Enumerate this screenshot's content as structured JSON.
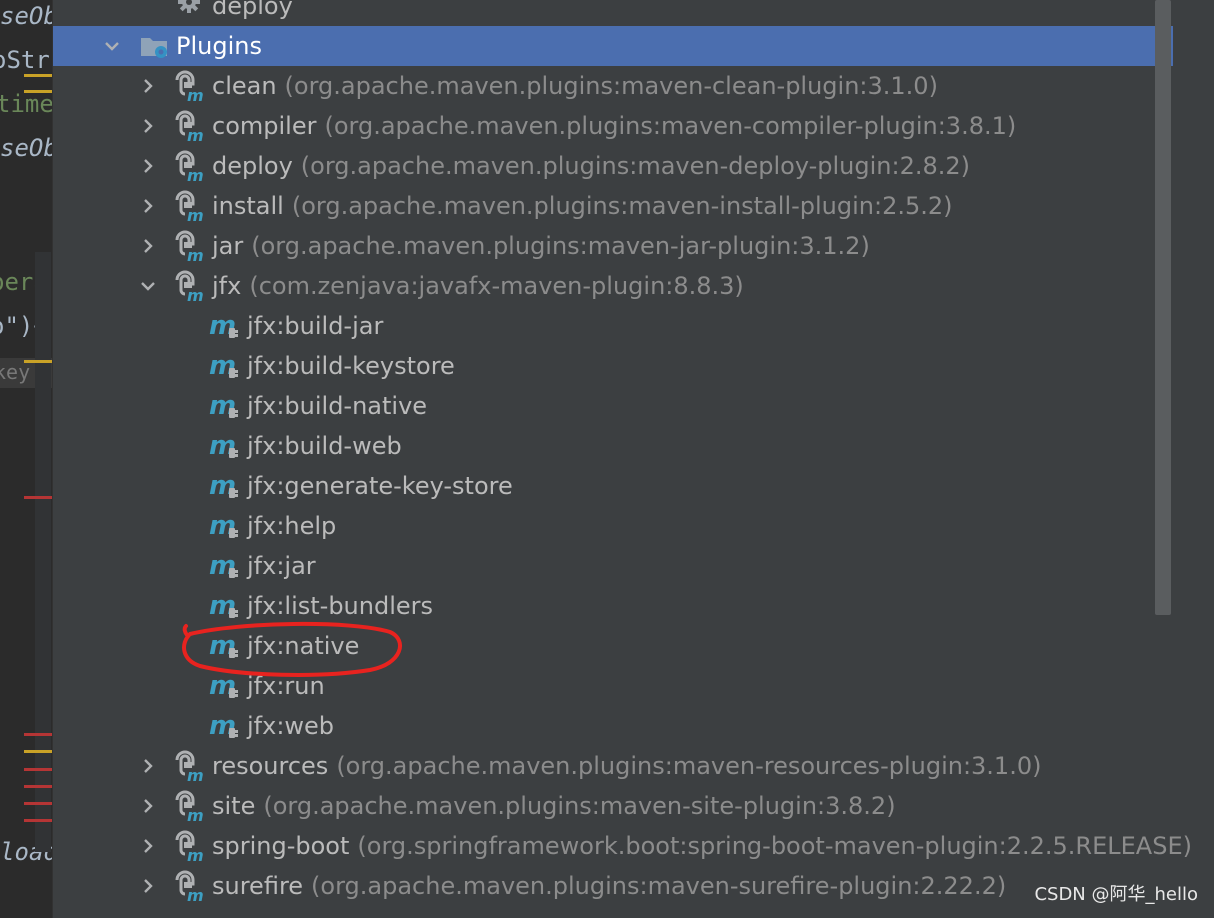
{
  "code_strip": {
    "fragments": [
      "seOb",
      "oStr",
      "time",
      "seOb",
      "pera",
      "o\")+",
      "key",
      "load"
    ]
  },
  "tree": {
    "items": [
      {
        "label": "deploy",
        "coord": "",
        "icon": "gear-icon",
        "level": 2,
        "chevron": "none",
        "selected": false
      },
      {
        "label": "Plugins",
        "coord": "",
        "icon": "plugins-folder-icon",
        "level": 1,
        "chevron": "expanded",
        "selected": true
      },
      {
        "label": "clean",
        "coord": "(org.apache.maven.plugins:maven-clean-plugin:3.1.0)",
        "icon": "maven-plugin-icon",
        "level": 2,
        "chevron": "collapsed",
        "selected": false
      },
      {
        "label": "compiler",
        "coord": "(org.apache.maven.plugins:maven-compiler-plugin:3.8.1)",
        "icon": "maven-plugin-icon",
        "level": 2,
        "chevron": "collapsed",
        "selected": false
      },
      {
        "label": "deploy",
        "coord": "(org.apache.maven.plugins:maven-deploy-plugin:2.8.2)",
        "icon": "maven-plugin-icon",
        "level": 2,
        "chevron": "collapsed",
        "selected": false
      },
      {
        "label": "install",
        "coord": "(org.apache.maven.plugins:maven-install-plugin:2.5.2)",
        "icon": "maven-plugin-icon",
        "level": 2,
        "chevron": "collapsed",
        "selected": false
      },
      {
        "label": "jar",
        "coord": "(org.apache.maven.plugins:maven-jar-plugin:3.1.2)",
        "icon": "maven-plugin-icon",
        "level": 2,
        "chevron": "collapsed",
        "selected": false
      },
      {
        "label": "jfx",
        "coord": "(com.zenjava:javafx-maven-plugin:8.8.3)",
        "icon": "maven-plugin-icon",
        "level": 2,
        "chevron": "expanded",
        "selected": false
      },
      {
        "label": "jfx:build-jar",
        "coord": "",
        "icon": "maven-goal-icon",
        "level": 3,
        "chevron": "none",
        "selected": false
      },
      {
        "label": "jfx:build-keystore",
        "coord": "",
        "icon": "maven-goal-icon",
        "level": 3,
        "chevron": "none",
        "selected": false
      },
      {
        "label": "jfx:build-native",
        "coord": "",
        "icon": "maven-goal-icon",
        "level": 3,
        "chevron": "none",
        "selected": false
      },
      {
        "label": "jfx:build-web",
        "coord": "",
        "icon": "maven-goal-icon",
        "level": 3,
        "chevron": "none",
        "selected": false
      },
      {
        "label": "jfx:generate-key-store",
        "coord": "",
        "icon": "maven-goal-icon",
        "level": 3,
        "chevron": "none",
        "selected": false
      },
      {
        "label": "jfx:help",
        "coord": "",
        "icon": "maven-goal-icon",
        "level": 3,
        "chevron": "none",
        "selected": false
      },
      {
        "label": "jfx:jar",
        "coord": "",
        "icon": "maven-goal-icon",
        "level": 3,
        "chevron": "none",
        "selected": false
      },
      {
        "label": "jfx:list-bundlers",
        "coord": "",
        "icon": "maven-goal-icon",
        "level": 3,
        "chevron": "none",
        "selected": false
      },
      {
        "label": "jfx:native",
        "coord": "",
        "icon": "maven-goal-icon",
        "level": 3,
        "chevron": "none",
        "selected": false
      },
      {
        "label": "jfx:run",
        "coord": "",
        "icon": "maven-goal-icon",
        "level": 3,
        "chevron": "none",
        "selected": false
      },
      {
        "label": "jfx:web",
        "coord": "",
        "icon": "maven-goal-icon",
        "level": 3,
        "chevron": "none",
        "selected": false
      },
      {
        "label": "resources",
        "coord": "(org.apache.maven.plugins:maven-resources-plugin:3.1.0)",
        "icon": "maven-plugin-icon",
        "level": 2,
        "chevron": "collapsed",
        "selected": false
      },
      {
        "label": "site",
        "coord": "(org.apache.maven.plugins:maven-site-plugin:3.8.2)",
        "icon": "maven-plugin-icon",
        "level": 2,
        "chevron": "collapsed",
        "selected": false
      },
      {
        "label": "spring-boot",
        "coord": "(org.springframework.boot:spring-boot-maven-plugin:2.2.5.RELEASE)",
        "icon": "maven-plugin-icon",
        "level": 2,
        "chevron": "collapsed",
        "selected": false
      },
      {
        "label": "surefire",
        "coord": "(org.apache.maven.plugins:maven-surefire-plugin:2.22.2)",
        "icon": "maven-plugin-icon",
        "level": 2,
        "chevron": "collapsed",
        "selected": false
      }
    ]
  },
  "colors": {
    "background": "#3c3f41",
    "selection": "#4b6eaf",
    "annotation": "#e8231f",
    "maven_goal_icon": "#3d9fc2"
  },
  "watermark": "CSDN @阿华_hello"
}
